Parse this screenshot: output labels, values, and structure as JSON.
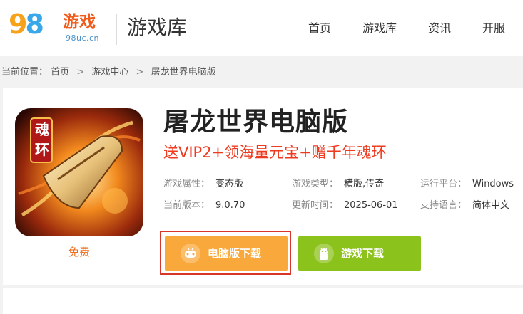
{
  "header": {
    "logo": {
      "digits_9": "9",
      "digits_8": "8",
      "brand": "游戏",
      "domain": "98uc.cn"
    },
    "site_title": "游戏库",
    "nav": [
      "首页",
      "游戏库",
      "资讯",
      "开服"
    ]
  },
  "breadcrumb": {
    "label": "当前位置：",
    "items": [
      "首页",
      "游戏中心",
      "屠龙世界电脑版"
    ],
    "separator": ">"
  },
  "game": {
    "icon_text": "魂环",
    "price_label": "免费",
    "title": "屠龙世界电脑版",
    "promo": "送VIP2+领海量元宝+赠千年魂环",
    "attributes": [
      {
        "key": "游戏属性：",
        "value": "变态版"
      },
      {
        "key": "游戏类型：",
        "value": "横版,传奇"
      },
      {
        "key": "运行平台：",
        "value": "Windows"
      },
      {
        "key": "当前版本：",
        "value": "9.0.70"
      },
      {
        "key": "更新时间：",
        "value": "2025-06-01"
      },
      {
        "key": "支持语言：",
        "value": "简体中文"
      }
    ],
    "buttons": {
      "pc": "电脑版下载",
      "android": "游戏下载"
    }
  },
  "colors": {
    "accent_orange": "#f9a93b",
    "accent_green": "#8cc21c",
    "promo_red": "#ee3a1f",
    "highlight_red": "#d9362b"
  }
}
